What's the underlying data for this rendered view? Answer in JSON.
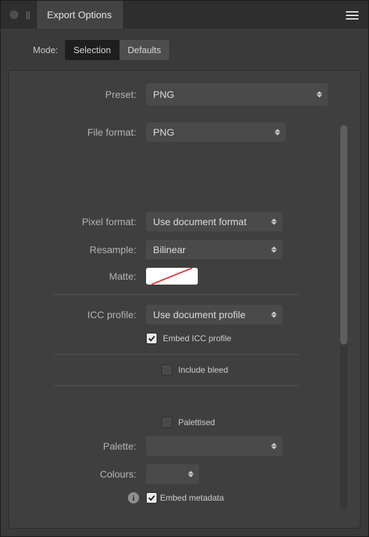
{
  "panel": {
    "title": "Export Options"
  },
  "mode": {
    "label": "Mode:",
    "selection": "Selection",
    "defaults": "Defaults"
  },
  "fields": {
    "preset_label": "Preset:",
    "preset_value": "PNG",
    "fileformat_label": "File format:",
    "fileformat_value": "PNG",
    "pixelformat_label": "Pixel format:",
    "pixelformat_value": "Use document format",
    "resample_label": "Resample:",
    "resample_value": "Bilinear",
    "matte_label": "Matte:",
    "iccprofile_label": "ICC profile:",
    "iccprofile_value": "Use document profile",
    "embed_icc_label": "Embed ICC profile",
    "include_bleed_label": "Include bleed",
    "palettised_label": "Palettised",
    "palette_label": "Palette:",
    "palette_value": "",
    "colours_label": "Colours:",
    "colours_value": "",
    "embed_metadata_label": "Embed metadata"
  },
  "checks": {
    "embed_icc": true,
    "include_bleed": false,
    "palettised": false,
    "embed_metadata": true
  }
}
